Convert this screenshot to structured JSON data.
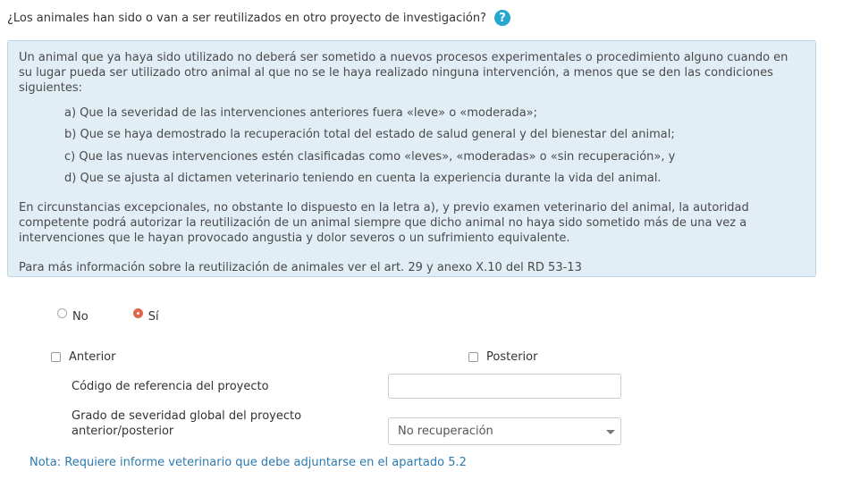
{
  "question": {
    "text": "¿Los animales han sido o van a ser reutilizados en otro proyecto de investigación?",
    "help_glyph": "?"
  },
  "info": {
    "intro": "Un animal que ya haya sido utilizado no deberá ser sometido a nuevos procesos experimentales o procedimiento alguno cuando en su lugar pueda ser utilizado otro animal al que no se le haya realizado ninguna intervención, a menos que se den las condiciones siguientes:",
    "conditions": [
      "a) Que la severidad de las intervenciones anteriores fuera «leve» o «moderada»;",
      "b) Que se haya demostrado la recuperación total del estado de salud general y del bienestar del animal;",
      "c) Que las nuevas intervenciones estén clasificadas como «leves», «moderadas» o «sin recuperación», y",
      "d) Que se ajusta al dictamen veterinario teniendo en cuenta la experiencia durante la vida del animal."
    ],
    "exception": "En circunstancias excepcionales, no obstante lo dispuesto en la letra a), y previo examen veterinario del animal, la autoridad competente podrá autorizar la reutilización de un animal siempre que dicho animal no haya sido sometido más de una vez a intervenciones que le hayan provocado angustia y dolor severos o un sufrimiento equivalente.",
    "more": "Para más información sobre la reutilización de animales ver el art. 29 y anexo X.10 del RD 53-13"
  },
  "reuse_radio": {
    "options": [
      "No",
      "Sí"
    ],
    "selected": "Sí"
  },
  "timing": {
    "anterior_label": "Anterior",
    "anterior_checked": false,
    "posterior_label": "Posterior",
    "posterior_checked": false
  },
  "form": {
    "ref_code_label": "Código de referencia del proyecto",
    "ref_code_value": "",
    "severity_label_line1": "Grado de severidad global del proyecto",
    "severity_label_line2": "anterior/posterior",
    "severity_value": "No recuperación"
  },
  "note": "Nota: Requiere informe veterinario que debe adjuntarse en el apartado 5.2",
  "colors": {
    "accent": "#e0674a",
    "info_bg": "#e2eef5",
    "help_icon": "#26a7cf",
    "note_text": "#2b7ab0"
  }
}
